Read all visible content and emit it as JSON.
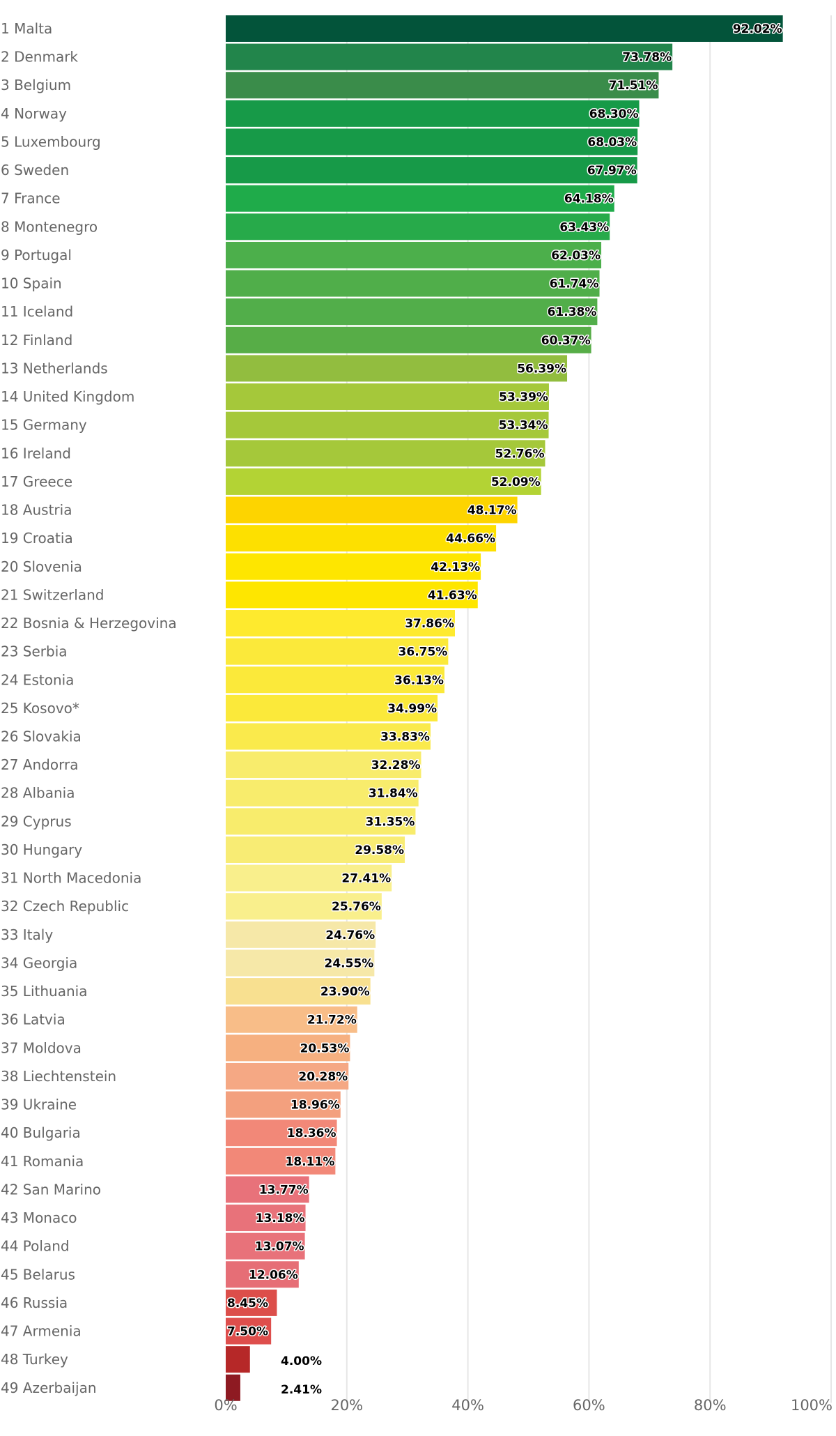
{
  "chart_data": {
    "type": "bar",
    "orientation": "horizontal",
    "title": "",
    "xlabel": "",
    "ylabel": "",
    "xlim": [
      0,
      100
    ],
    "x_ticks": [
      "0%",
      "20%",
      "40%",
      "60%",
      "80%",
      "100%"
    ],
    "grid": true,
    "legend": "none",
    "value_suffix": "%",
    "categories": [
      "1 Malta",
      "2 Denmark",
      "3 Belgium",
      "4 Norway",
      "5 Luxembourg",
      "6 Sweden",
      "7 France",
      "8 Montenegro",
      "9 Portugal",
      "10 Spain",
      "11 Iceland",
      "12 Finland",
      "13 Netherlands",
      "14 United Kingdom",
      "15 Germany",
      "16 Ireland",
      "17 Greece",
      "18 Austria",
      "19 Croatia",
      "20 Slovenia",
      "21 Switzerland",
      "22 Bosnia & Herzegovina",
      "23 Serbia",
      "24 Estonia",
      "25 Kosovo*",
      "26 Slovakia",
      "27 Andorra",
      "28 Albania",
      "29 Cyprus",
      "30 Hungary",
      "31 North Macedonia",
      "32 Czech Republic",
      "33 Italy",
      "34 Georgia",
      "35 Lithuania",
      "36 Latvia",
      "37 Moldova",
      "38 Liechtenstein",
      "39 Ukraine",
      "40 Bulgaria",
      "41 Romania",
      "42 San Marino",
      "43 Monaco",
      "44 Poland",
      "45 Belarus",
      "46 Russia",
      "47 Armenia",
      "48 Turkey",
      "49 Azerbaijan"
    ],
    "values": [
      92.02,
      73.78,
      71.51,
      68.3,
      68.03,
      67.97,
      64.18,
      63.43,
      62.03,
      61.74,
      61.38,
      60.37,
      56.39,
      53.39,
      53.34,
      52.76,
      52.09,
      48.17,
      44.66,
      42.13,
      41.63,
      37.86,
      36.75,
      36.13,
      34.99,
      33.83,
      32.28,
      31.84,
      31.35,
      29.58,
      27.41,
      25.76,
      24.76,
      24.55,
      23.9,
      21.72,
      20.53,
      20.28,
      18.96,
      18.36,
      18.11,
      13.77,
      13.18,
      13.07,
      12.06,
      8.45,
      7.5,
      4.0,
      2.41
    ],
    "value_labels": [
      "92.02%",
      "73.78%",
      "71.51%",
      "68.30%",
      "68.03%",
      "67.97%",
      "64.18%",
      "63.43%",
      "62.03%",
      "61.74%",
      "61.38%",
      "60.37%",
      "56.39%",
      "53.39%",
      "53.34%",
      "52.76%",
      "52.09%",
      "48.17%",
      "44.66%",
      "42.13%",
      "41.63%",
      "37.86%",
      "36.75%",
      "36.13%",
      "34.99%",
      "33.83%",
      "32.28%",
      "31.84%",
      "31.35%",
      "29.58%",
      "27.41%",
      "25.76%",
      "24.76%",
      "24.55%",
      "23.90%",
      "21.72%",
      "20.53%",
      "20.28%",
      "18.96%",
      "18.36%",
      "18.11%",
      "13.77%",
      "13.18%",
      "13.07%",
      "12.06%",
      "8.45%",
      "7.50%",
      "4.00%",
      "2.41%"
    ],
    "colors": [
      "#03543a",
      "#22854b",
      "#3a8c4a",
      "#179a48",
      "#179a48",
      "#179a48",
      "#1fab4a",
      "#27aa4a",
      "#4caf4b",
      "#50ae4a",
      "#52ae4a",
      "#57ad47",
      "#92bd3f",
      "#a5c83a",
      "#a5c83a",
      "#a5c83a",
      "#b3d334",
      "#fdd400",
      "#fde000",
      "#fee600",
      "#fee600",
      "#feea2e",
      "#fbe93a",
      "#fbe93a",
      "#fbe93a",
      "#faea4c",
      "#f8ec6c",
      "#f8ec6c",
      "#f8ec6c",
      "#f8ec74",
      "#f9ef8c",
      "#f9ef8c",
      "#f6e8a8",
      "#f6e8a8",
      "#f8e090",
      "#f8bd88",
      "#f6b080",
      "#f5a884",
      "#f3a07e",
      "#f28878",
      "#f28878",
      "#e8727a",
      "#e8727a",
      "#e8727a",
      "#e66e76",
      "#dc4e4a",
      "#de4e4c",
      "#b62828",
      "#8e1a22"
    ]
  }
}
